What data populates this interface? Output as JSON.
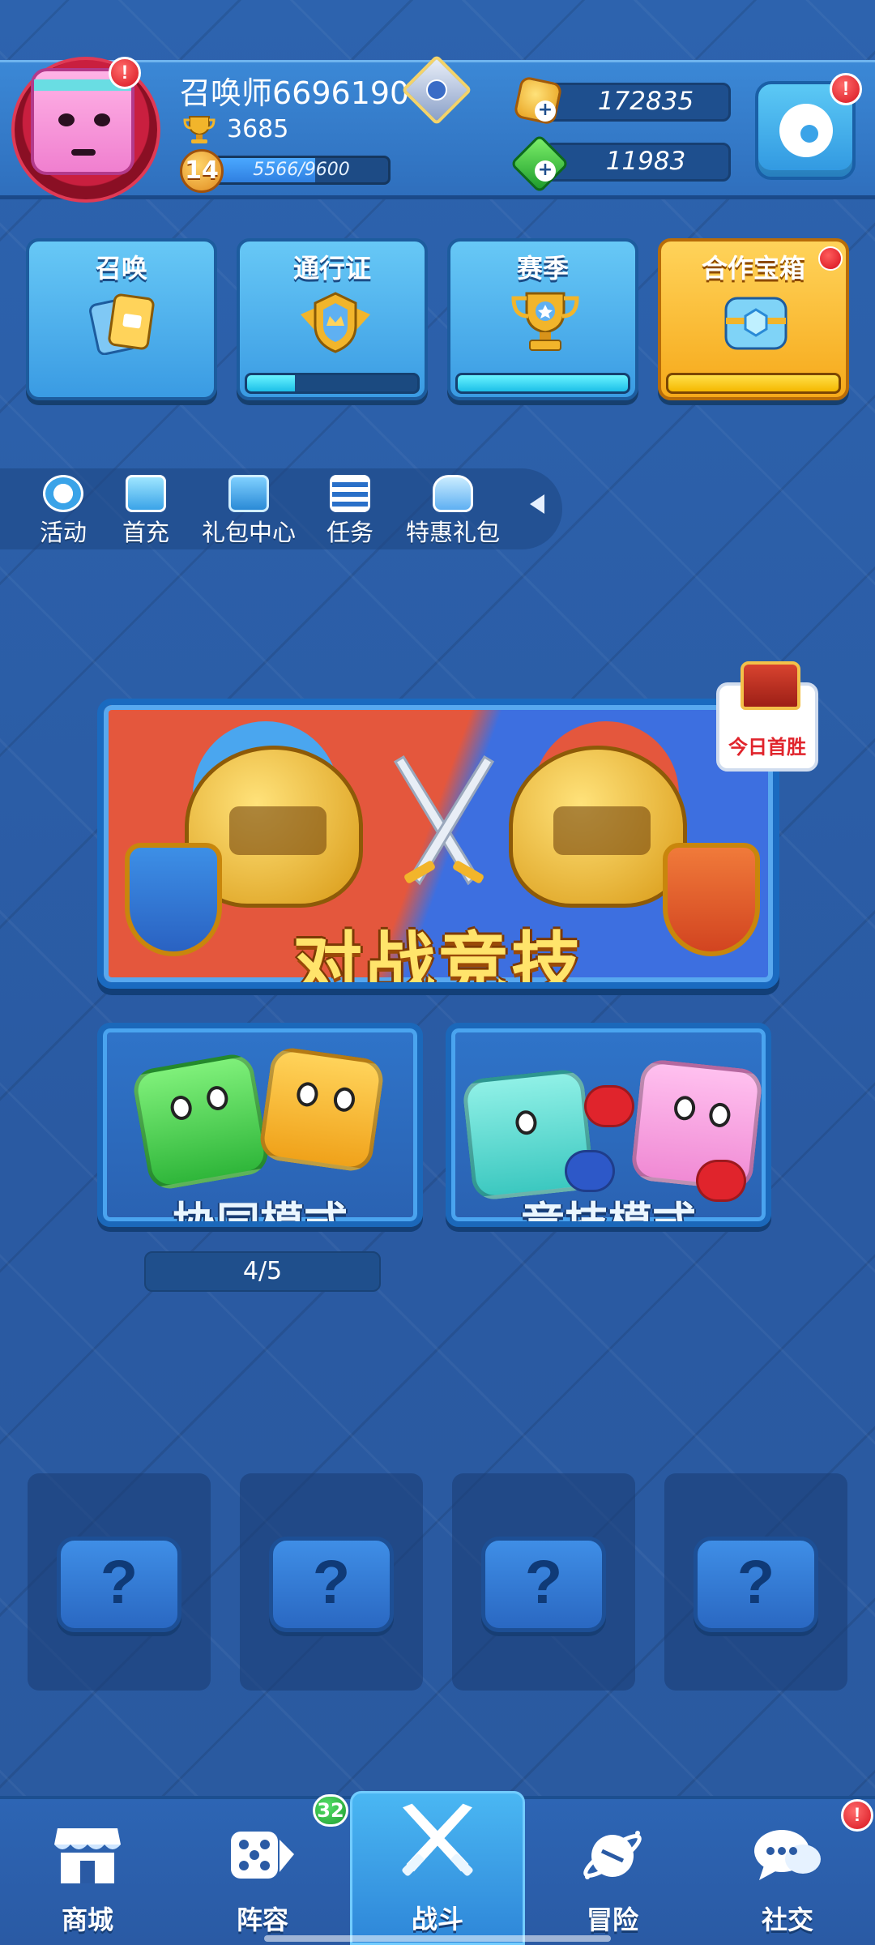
{
  "header": {
    "username": "召唤师6696190",
    "trophies": "3685",
    "level": "14",
    "xp_text": "5566/9600",
    "xp_fraction": 0.58,
    "gold": "172835",
    "gems": "11983",
    "avatar_alert": "!",
    "settings_alert": "!"
  },
  "cards": [
    {
      "title": "召唤",
      "progress": null
    },
    {
      "title": "通行证",
      "progress": 0.28
    },
    {
      "title": "赛季",
      "progress": 1.0
    },
    {
      "title": "合作宝箱",
      "progress": 1.0,
      "has_dot": true
    }
  ],
  "activities": [
    {
      "label": "活动",
      "icon": "crown-badge-icon"
    },
    {
      "label": "首充",
      "icon": "gift-icon"
    },
    {
      "label": "礼包中心",
      "icon": "gift-box-icon"
    },
    {
      "label": "任务",
      "icon": "checklist-icon"
    },
    {
      "label": "特惠礼包",
      "icon": "bag-icon"
    }
  ],
  "battle": {
    "title": "对战竞技",
    "first_win": "今日首胜"
  },
  "modes": {
    "coop_title": "协同模式",
    "coop_progress": "4/5",
    "pvp_title": "竞技模式"
  },
  "slots": {
    "symbol": "?"
  },
  "nav": {
    "items": [
      {
        "label": "商城",
        "icon": "shop-icon"
      },
      {
        "label": "阵容",
        "icon": "dice-icon",
        "badge": "32"
      },
      {
        "label": "战斗",
        "icon": "crossed-swords-icon"
      },
      {
        "label": "冒险",
        "icon": "planet-icon"
      },
      {
        "label": "社交",
        "icon": "chat-bubbles-icon",
        "alert": "!"
      }
    ]
  },
  "colors": {
    "background": "#2a5da6",
    "accent_gold": "#ffd35a",
    "alert_red": "#d7141f",
    "badge_green": "#1f9c2f"
  }
}
